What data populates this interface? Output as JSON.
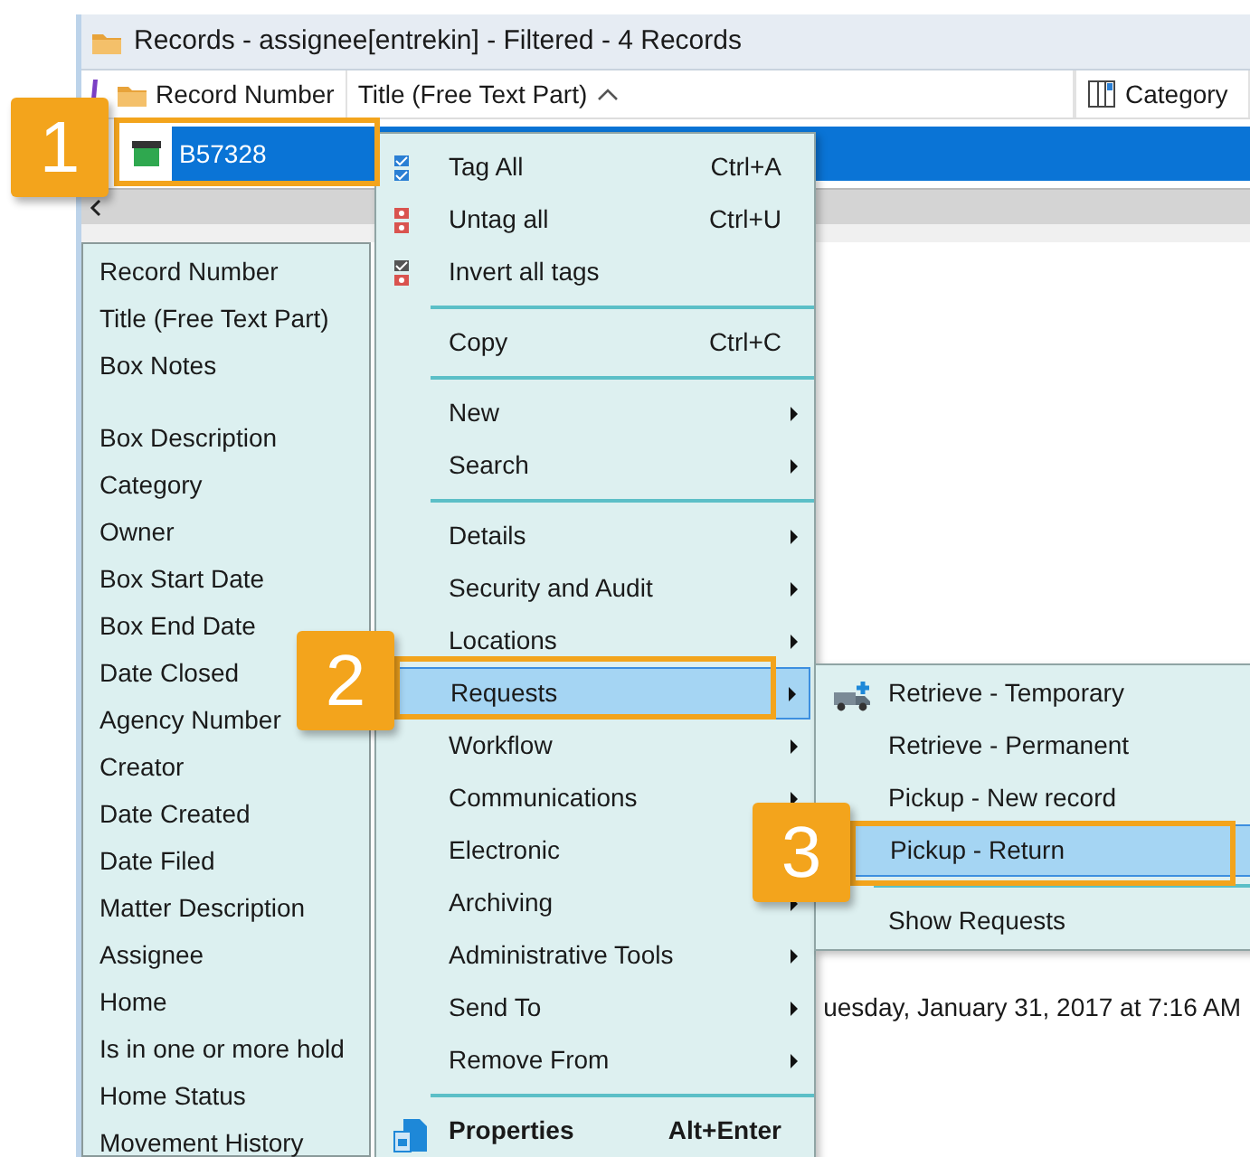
{
  "window": {
    "title": "Records - assignee[entrekin] - Filtered - 4 Records"
  },
  "table": {
    "columns": [
      {
        "label": "Record Number",
        "sorted": false
      },
      {
        "label": "Title (Free Text Part)",
        "sorted": true
      },
      {
        "label": "Category",
        "sorted": false
      }
    ],
    "rows": [
      {
        "record_number": "B57328",
        "selected": true
      }
    ]
  },
  "field_list": {
    "groups": [
      [
        "Record Number",
        "Title (Free Text Part)",
        "Box Notes"
      ],
      [
        "Box Description",
        "Category",
        "Owner",
        "Box Start Date",
        "Box End Date",
        "Date Closed",
        "Agency Number",
        "Creator",
        "Date Created",
        "Date Filed",
        "Matter Description",
        "Assignee",
        "Home",
        "Is in one or more hold",
        "Home Status",
        "Movement History"
      ]
    ]
  },
  "detail_text": "uesday, January 31, 2017 at 7:16 AM",
  "context_menu": {
    "items": [
      {
        "kind": "item",
        "label": "Tag All",
        "shortcut": "Ctrl+A",
        "submenu": false,
        "selected": false,
        "default": false
      },
      {
        "kind": "item",
        "label": "Untag all",
        "shortcut": "Ctrl+U",
        "submenu": false,
        "selected": false,
        "default": false
      },
      {
        "kind": "item",
        "label": "Invert all tags",
        "submenu": false,
        "selected": false,
        "default": false
      },
      {
        "kind": "separator"
      },
      {
        "kind": "item",
        "label": "Copy",
        "shortcut": "Ctrl+C",
        "submenu": false,
        "selected": false,
        "default": false
      },
      {
        "kind": "separator"
      },
      {
        "kind": "item",
        "label": "New",
        "submenu": true,
        "selected": false,
        "default": false
      },
      {
        "kind": "item",
        "label": "Search",
        "submenu": true,
        "selected": false,
        "default": false
      },
      {
        "kind": "separator"
      },
      {
        "kind": "item",
        "label": "Details",
        "submenu": true,
        "selected": false,
        "default": false
      },
      {
        "kind": "item",
        "label": "Security and Audit",
        "submenu": true,
        "selected": false,
        "default": false
      },
      {
        "kind": "item",
        "label": "Locations",
        "submenu": true,
        "selected": false,
        "default": false
      },
      {
        "kind": "item",
        "label": "Requests",
        "submenu": true,
        "selected": true,
        "default": false
      },
      {
        "kind": "item",
        "label": "Workflow",
        "submenu": true,
        "selected": false,
        "default": false
      },
      {
        "kind": "item",
        "label": "Communications",
        "submenu": true,
        "selected": false,
        "default": false
      },
      {
        "kind": "item",
        "label": "Electronic",
        "selected": false,
        "default": false
      },
      {
        "kind": "item",
        "label": "Archiving",
        "submenu": true,
        "selected": false,
        "default": false
      },
      {
        "kind": "item",
        "label": "Administrative Tools",
        "submenu": true,
        "selected": false,
        "default": false
      },
      {
        "kind": "item",
        "label": "Send To",
        "submenu": true,
        "selected": false,
        "default": false
      },
      {
        "kind": "item",
        "label": "Remove From",
        "submenu": true,
        "selected": false,
        "default": false
      },
      {
        "kind": "separator"
      },
      {
        "kind": "item",
        "label": "Properties",
        "shortcut": "Alt+Enter",
        "submenu": false,
        "selected": false,
        "default": true
      }
    ]
  },
  "submenu": {
    "items": [
      {
        "kind": "item",
        "label": "Retrieve - Temporary",
        "selected": false
      },
      {
        "kind": "item",
        "label": "Retrieve - Permanent",
        "selected": false
      },
      {
        "kind": "item",
        "label": "Pickup - New record",
        "selected": false
      },
      {
        "kind": "item",
        "label": "Pickup - Return",
        "selected": true
      },
      {
        "kind": "separator"
      },
      {
        "kind": "item",
        "label": "Show Requests",
        "selected": false
      }
    ]
  },
  "callouts": [
    {
      "number": "1"
    },
    {
      "number": "2"
    },
    {
      "number": "3"
    }
  ]
}
